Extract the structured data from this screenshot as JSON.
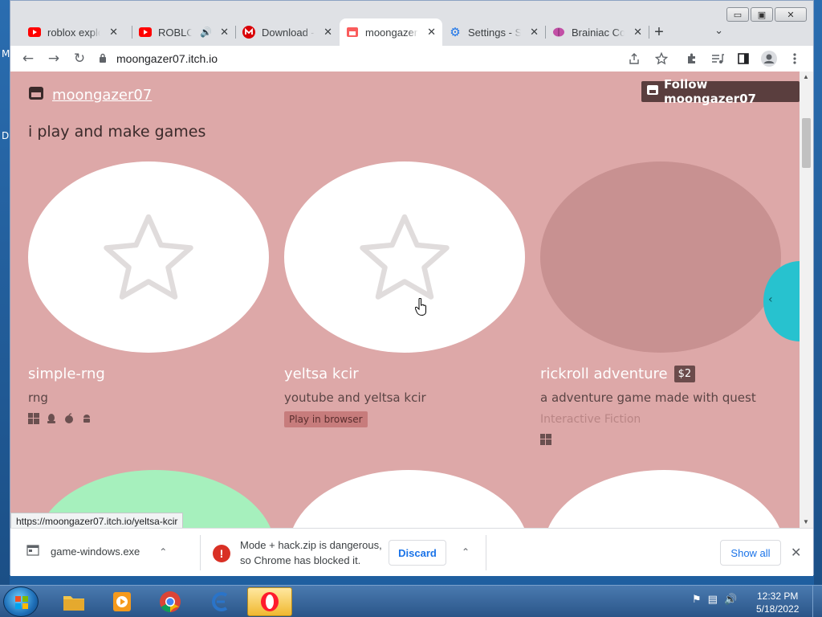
{
  "desktop": {
    "left_letters": [
      "M",
      "D"
    ]
  },
  "window_controls": {
    "minimize": "▭",
    "maximize": "▣",
    "close": "✕"
  },
  "tabs": [
    {
      "title": "roblox explo",
      "icon": "youtube-icon",
      "active": false
    },
    {
      "title": "ROBLOX",
      "icon": "youtube-icon",
      "active": false,
      "audio": true
    },
    {
      "title": "Download -",
      "icon": "mega-icon",
      "active": false
    },
    {
      "title": "moongazer",
      "icon": "itchio-icon",
      "active": true
    },
    {
      "title": "Settings - S",
      "icon": "settings-icon",
      "active": false
    },
    {
      "title": "Brainiac Co",
      "icon": "brain-icon",
      "active": false
    }
  ],
  "tab_close": "✕",
  "new_tab": "+",
  "tab_search": "⌄",
  "toolbar": {
    "back": "←",
    "forward": "→",
    "reload": "↻",
    "url": "moongazer07.itch.io",
    "lock": "🔒"
  },
  "page": {
    "brand": "moongazer07",
    "follow_label": "Follow moongazer07",
    "tagline": "i play and make games",
    "games": [
      {
        "title": "simple-rng",
        "description": "rng",
        "platforms": [
          "windows",
          "linux",
          "mac",
          "android"
        ]
      },
      {
        "title": "yeltsa kcir",
        "description": "youtube and yeltsa kcir",
        "badge": "Play in browser"
      },
      {
        "title": "rickroll adventure",
        "price": "$2",
        "description": "a adventure game made with quest",
        "genre": "Interactive Fiction",
        "platforms": [
          "windows"
        ]
      }
    ],
    "side_arrow": "‹"
  },
  "status_url": "https://moongazer07.itch.io/yeltsa-kcir",
  "downloads": {
    "file1": "game-windows.exe",
    "warning_line1": "Mode + hack.zip is dangerous,",
    "warning_line2": "so Chrome has blocked it.",
    "discard": "Discard",
    "show_all": "Show all",
    "chevron": "⌃",
    "close": "✕"
  },
  "taskbar": {
    "time": "12:32 PM",
    "date": "5/18/2022"
  },
  "colors": {
    "page_bg": "#dda8a8",
    "follow_bg": "#5a3e3e",
    "accent": "#1a73e8"
  }
}
